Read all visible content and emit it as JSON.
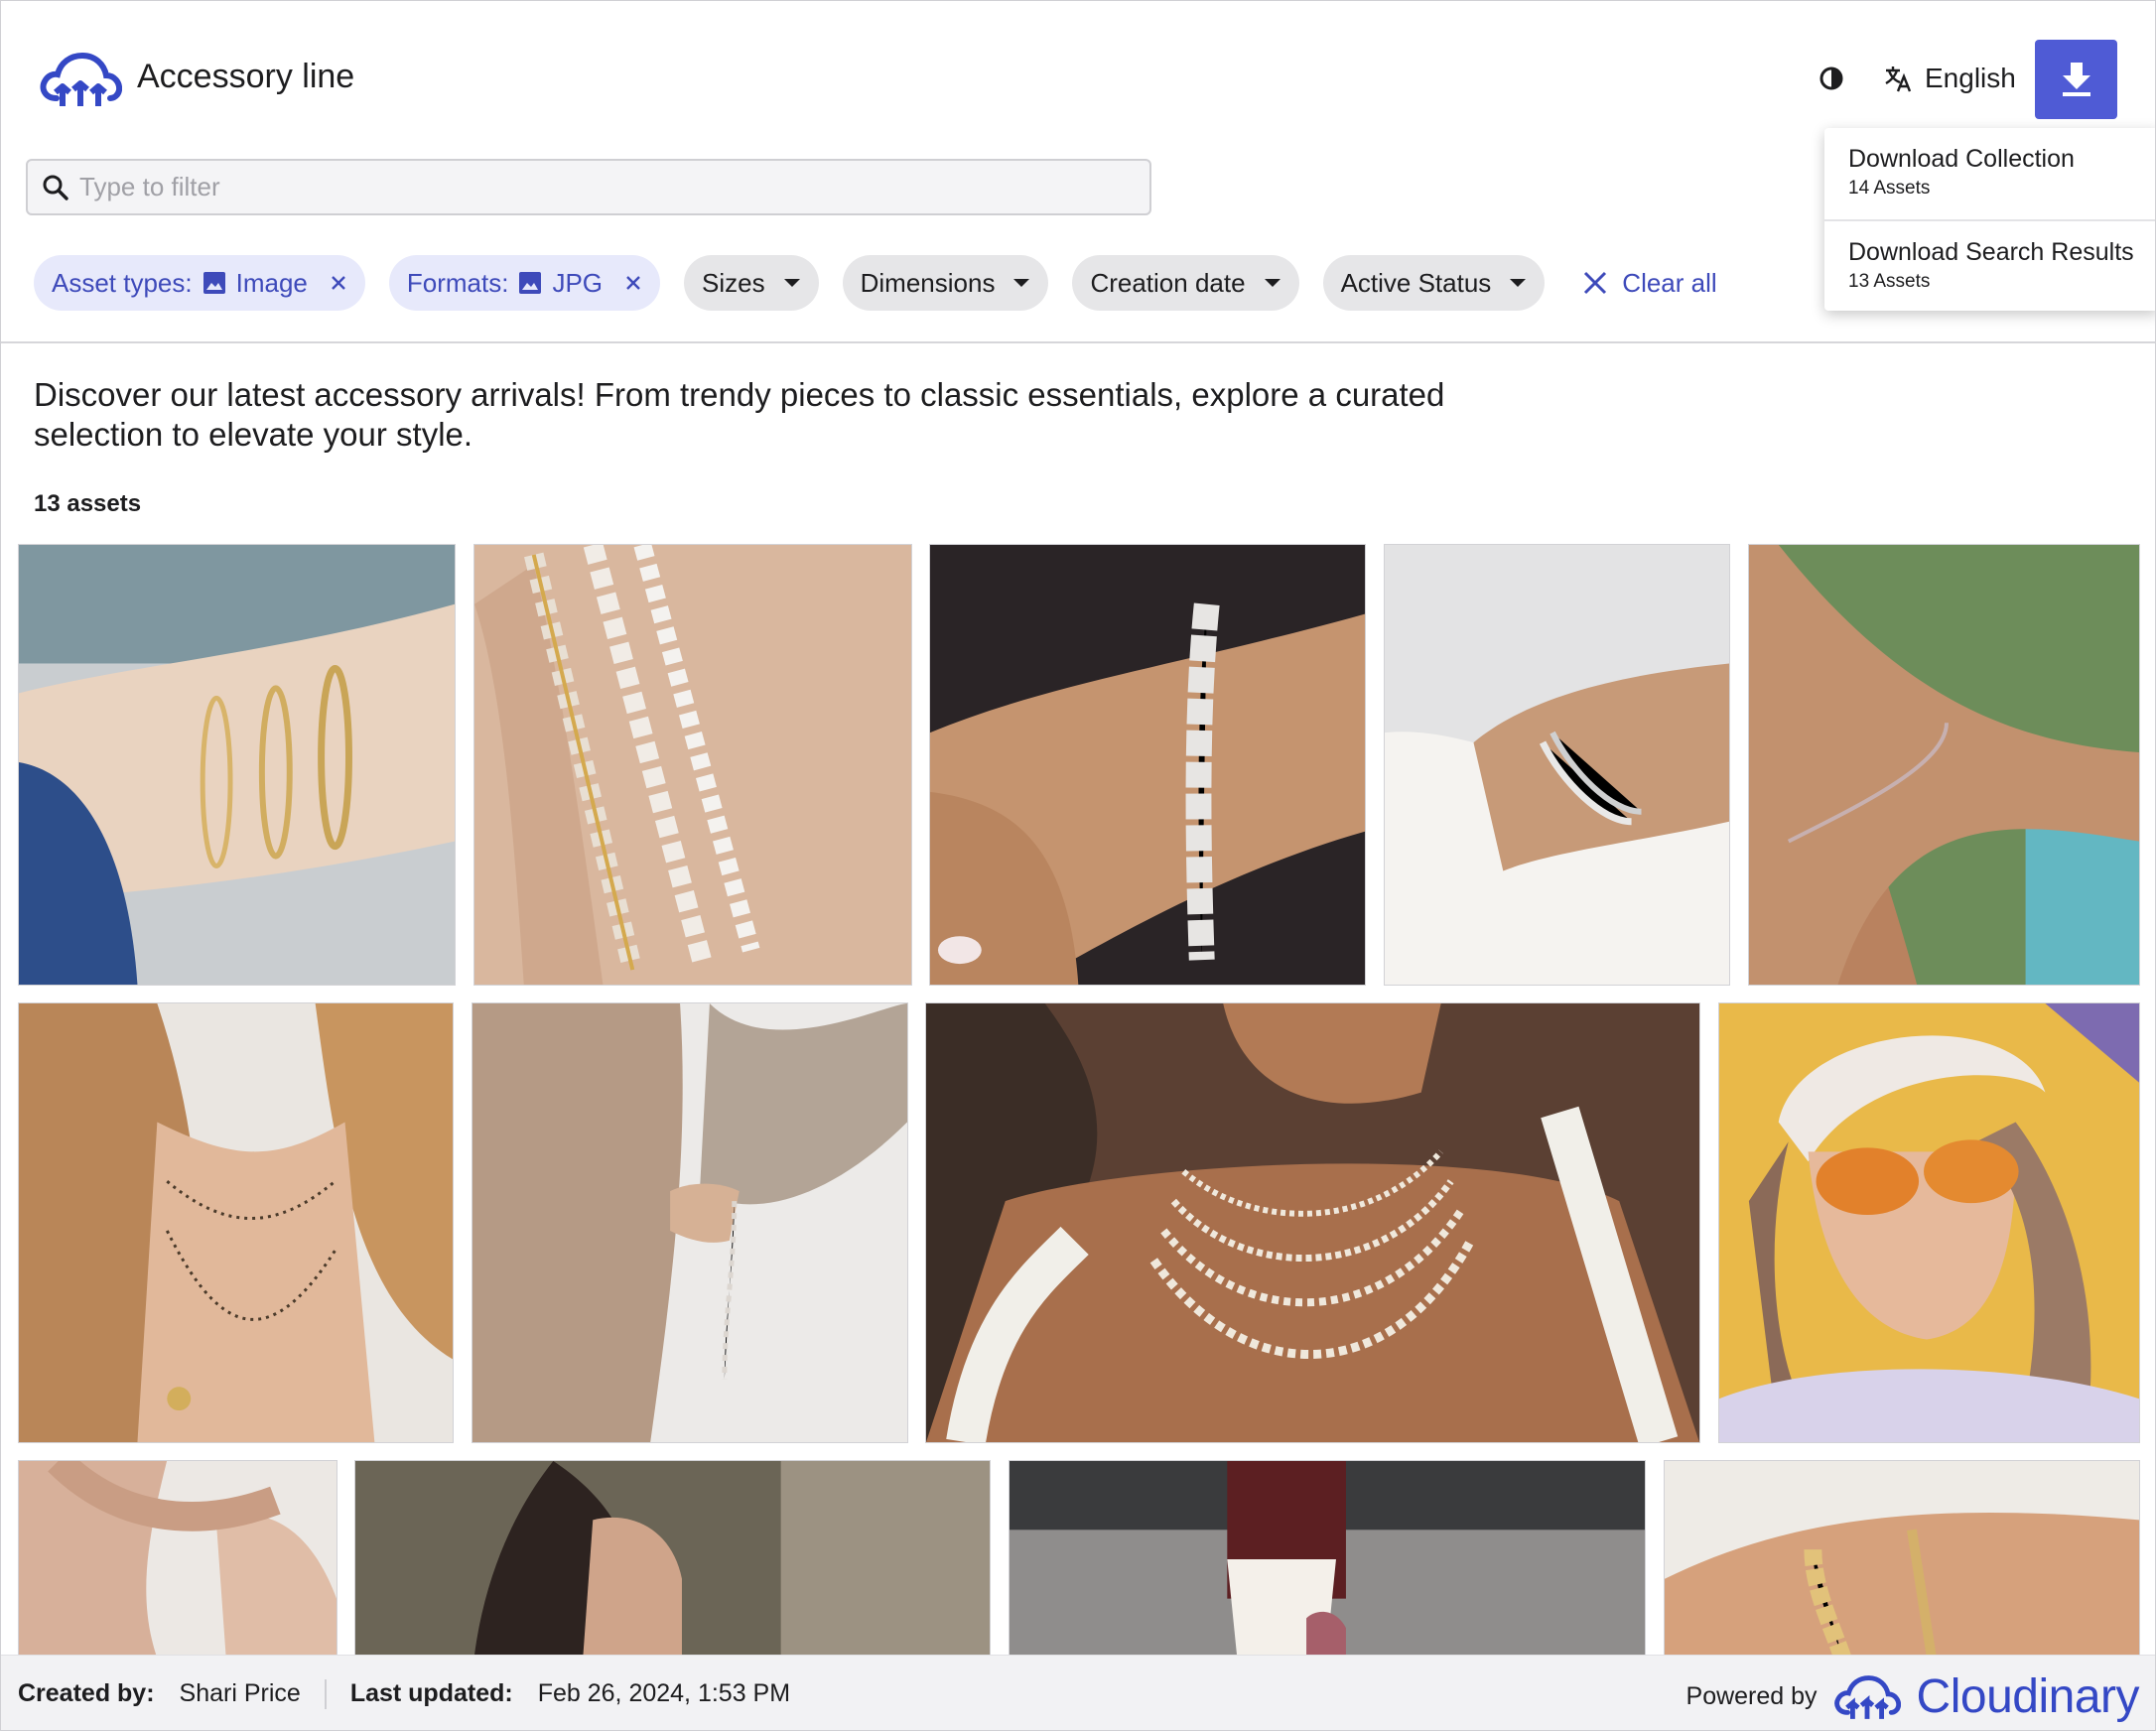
{
  "header": {
    "title": "Accessory line",
    "logo_icon": "cloudinary-cloud-icon",
    "contrast_icon": "contrast-icon",
    "language_label": "English",
    "language_icon": "translate-icon",
    "download_icon": "download-icon"
  },
  "search": {
    "placeholder": "Type to filter",
    "value": ""
  },
  "filters": {
    "chips": [
      {
        "prefix": "Asset types:",
        "value": "Image",
        "active": true
      },
      {
        "prefix": "Formats:",
        "value": "JPG",
        "active": true
      },
      {
        "label": "Sizes",
        "active": false
      },
      {
        "label": "Dimensions",
        "active": false
      },
      {
        "label": "Creation date",
        "active": false
      },
      {
        "label": "Active Status",
        "active": false
      }
    ],
    "clear_all": "Clear all"
  },
  "download_menu": {
    "items": [
      {
        "title": "Download Collection",
        "subtitle": "14 Assets"
      },
      {
        "title": "Download Search Results",
        "subtitle": "13 Assets"
      }
    ]
  },
  "description": "Discover our latest accessory arrivals! From trendy pieces to classic essentials, explore a curated selection to elevate your style.",
  "asset_count": "13 assets",
  "footer": {
    "created_by_label": "Created by:",
    "created_by": "Shari Price",
    "last_updated_label": "Last updated:",
    "last_updated": "Feb 26, 2024, 1:53 PM",
    "powered_by": "Powered by",
    "brand": "Cloudinary"
  },
  "colors": {
    "accent": "#4f5bd5",
    "chip_active_bg": "#e7e9fb",
    "chip_active_text": "#3e4aba",
    "brand": "#3448c5"
  }
}
